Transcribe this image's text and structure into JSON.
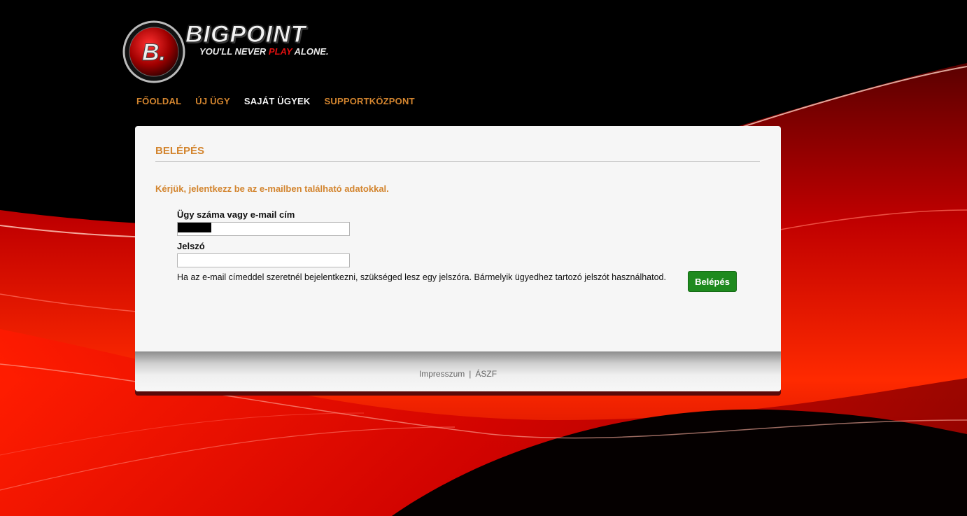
{
  "brand": {
    "logo_letter": "B.",
    "wordmark": "BIGPOINT",
    "tagline_pre": "YOU'LL NEVER ",
    "tagline_play": "PLAY",
    "tagline_post": " ALONE."
  },
  "nav": {
    "items": [
      {
        "label": "FŐOLDAL"
      },
      {
        "label": "ÚJ ÜGY"
      },
      {
        "label": "SAJÁT ÜGYEK"
      },
      {
        "label": "SUPPORTKÖZPONT"
      }
    ]
  },
  "panel": {
    "title": "BELÉPÉS",
    "intro": "Kérjük, jelentkezz be az e-mailben található adatokkal.",
    "email_label": "Ügy száma vagy e-mail cím",
    "password_label": "Jelszó",
    "hint": "Ha az e-mail címeddel szeretnél bejelentkezni, szükséged lesz egy jelszóra. Bármelyik ügyedhez tartozó jelszót használhatod.",
    "login_button": "Belépés"
  },
  "footer": {
    "impressum": "Impresszum",
    "separator": "|",
    "terms": "ÁSZF"
  },
  "colors": {
    "accent": "#d3852f",
    "button": "#1e8a1e",
    "background_red": "#e01010"
  }
}
